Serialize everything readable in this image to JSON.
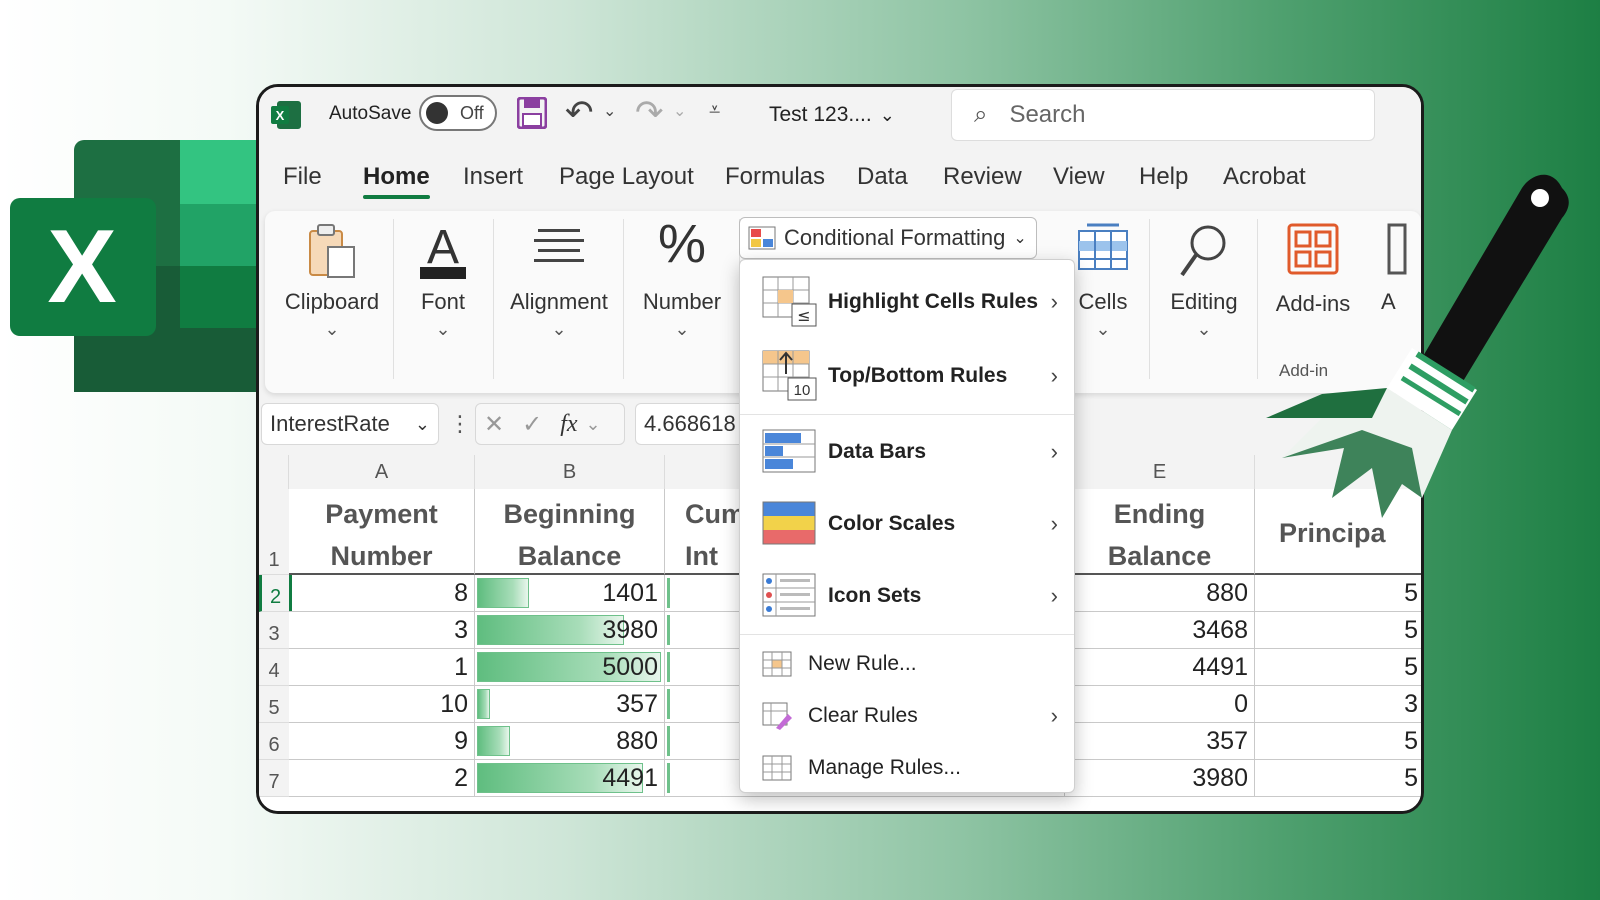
{
  "titlebar": {
    "autosave_label": "AutoSave",
    "autosave_state": "Off",
    "file_name": "Test 123....",
    "search_placeholder": "Search"
  },
  "tabs": [
    "File",
    "Home",
    "Insert",
    "Page Layout",
    "Formulas",
    "Data",
    "Review",
    "View",
    "Help",
    "Acrobat"
  ],
  "active_tab": "Home",
  "ribbon": {
    "groups": [
      "Clipboard",
      "Font",
      "Alignment",
      "Number",
      "Cells",
      "Editing",
      "Add-ins",
      "A"
    ],
    "addins_group_label": "Add-in",
    "conditional_formatting": "Conditional Formatting"
  },
  "formula_bar": {
    "name_box": "InterestRate",
    "fx": "fx",
    "value": "4.668618"
  },
  "sheet": {
    "columns": [
      "A",
      "B",
      "E"
    ],
    "headers": {
      "a": [
        "Payment",
        "Number"
      ],
      "b": [
        "Beginning",
        "Balance"
      ],
      "c": [
        "Cum",
        "Int"
      ],
      "e": [
        "Ending",
        "Balance"
      ],
      "f": "Principa"
    },
    "rows": [
      {
        "n": "2",
        "a": "8",
        "b": "1401",
        "e": "880",
        "f": "5",
        "bar": 0.28
      },
      {
        "n": "3",
        "a": "3",
        "b": "3980",
        "e": "3468",
        "f": "5",
        "bar": 0.8
      },
      {
        "n": "4",
        "a": "1",
        "b": "5000",
        "e": "4491",
        "f": "5",
        "bar": 1.0
      },
      {
        "n": "5",
        "a": "10",
        "b": "357",
        "e": "0",
        "f": "3",
        "bar": 0.07
      },
      {
        "n": "6",
        "a": "9",
        "b": "880",
        "e": "357",
        "f": "5",
        "bar": 0.18
      },
      {
        "n": "7",
        "a": "2",
        "b": "4491",
        "e": "3980",
        "f": "5",
        "bar": 0.9
      }
    ],
    "row1": "1"
  },
  "cf_menu": {
    "highlight": "Highlight Cells Rules",
    "topbottom": "Top/Bottom Rules",
    "databars": "Data Bars",
    "colorscales": "Color Scales",
    "iconsets": "Icon Sets",
    "newrule": "New Rule...",
    "clearrules": "Clear Rules",
    "managerules": "Manage Rules...",
    "topbottom_icon_text": "10",
    "highlight_icon_text": "≤"
  },
  "colors": {
    "excel_green": "#107c41",
    "data_bar": "#63be7b"
  }
}
